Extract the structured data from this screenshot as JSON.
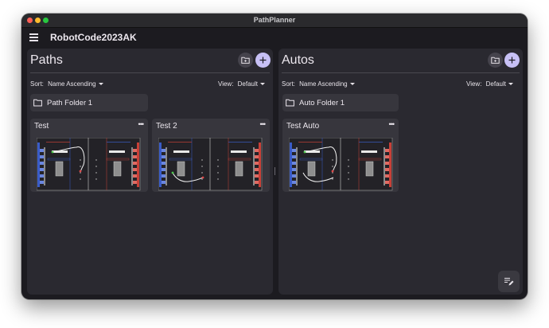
{
  "window": {
    "title": "PathPlanner"
  },
  "app": {
    "title": "RobotCode2023AK"
  },
  "paths": {
    "title": "Paths",
    "sort_label": "Sort:",
    "sort_value": "Name Ascending",
    "view_label": "View:",
    "view_value": "Default",
    "folder": "Path Folder 1",
    "cards": [
      {
        "name": "Test"
      },
      {
        "name": "Test 2"
      }
    ]
  },
  "autos": {
    "title": "Autos",
    "sort_label": "Sort:",
    "sort_value": "Name Ascending",
    "view_label": "View:",
    "view_value": "Default",
    "folder": "Auto Folder 1",
    "cards": [
      {
        "name": "Test Auto"
      }
    ]
  },
  "colors": {
    "accent": "#c7c0f5",
    "blue_alliance": "#3a5cc8",
    "red_alliance": "#c84038"
  },
  "icons": [
    "menu-icon",
    "folder-add-icon",
    "plus-icon",
    "folder-icon",
    "more-icon",
    "edit-note-icon"
  ]
}
